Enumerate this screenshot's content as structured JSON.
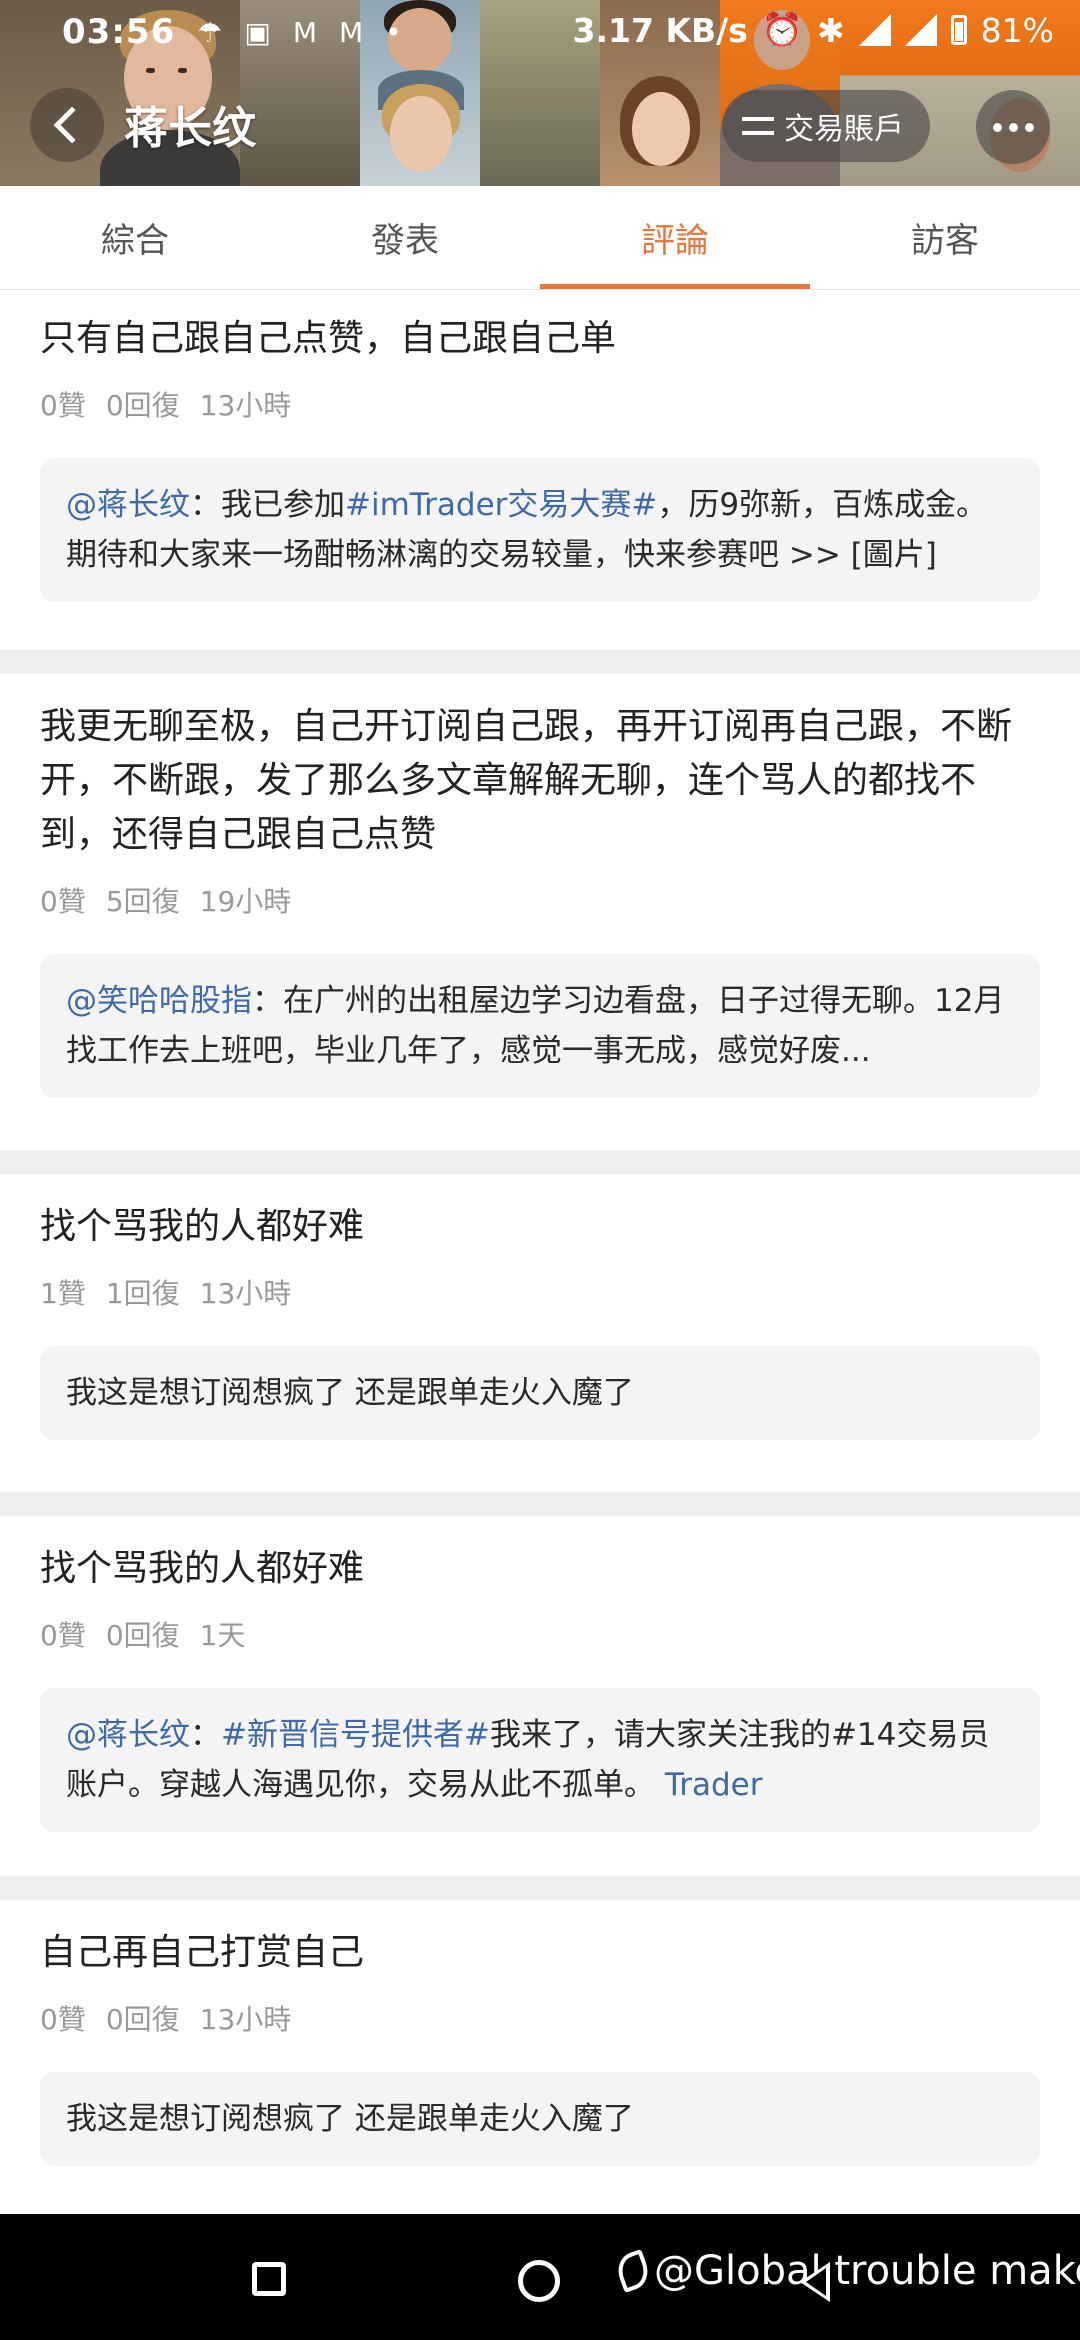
{
  "status_bar": {
    "time": "03:56",
    "net_speed": "3.17 KB/s",
    "battery": "81%",
    "left_icons": [
      "weather-icon",
      "image-icon",
      "gmail-icon",
      "gmail-icon"
    ]
  },
  "header": {
    "profile_name": "蒋长纹",
    "trade_account_label": "交易賬戶"
  },
  "tabs": [
    {
      "label": "綜合",
      "active": false
    },
    {
      "label": "發表",
      "active": false
    },
    {
      "label": "評論",
      "active": true
    },
    {
      "label": "訪客",
      "active": false
    }
  ],
  "comments": [
    {
      "text": "只有自己跟自己点赞，自己跟自己单",
      "likes": "0贊",
      "replies": "0回復",
      "time": "13小時",
      "quote": {
        "mention": "@蒋长纹",
        "sep": "：我已参加",
        "hashtag": "#imTrader交易大赛#",
        "body": "，历9弥新，百炼成金。期待和大家来一场酣畅淋漓的交易较量，快来参赛吧 >> [圖片]"
      }
    },
    {
      "text": "我更无聊至极，自己开订阅自己跟，再开订阅再自己跟，不断开，不断跟，发了那么多文章解解无聊，连个骂人的都找不到，还得自己跟自己点赞",
      "likes": "0贊",
      "replies": "5回復",
      "time": "19小時",
      "quote": {
        "mention": "@笑哈哈股指",
        "body": "：在广州的出租屋边学习边看盘，日子过得无聊。12月找工作去上班吧，毕业几年了，感觉一事无成，感觉好废..."
      }
    },
    {
      "text": "找个骂我的人都好难",
      "likes": "1贊",
      "replies": "1回復",
      "time": "13小時",
      "quote": {
        "body": "我这是想订阅想疯了 还是跟单走火入魔了"
      }
    },
    {
      "text": "找个骂我的人都好难",
      "likes": "0贊",
      "replies": "0回復",
      "time": "1天",
      "quote": {
        "mention": "@蒋长纹",
        "sep": "：",
        "hashtag": "#新晋信号提供者#",
        "body": "我来了，请大家关注我的#14交易员账户。穿越人海遇见你，交易从此不孤单。",
        "link": "Trader"
      }
    },
    {
      "text": "自己再自己打赏自己",
      "likes": "0贊",
      "replies": "0回復",
      "time": "13小時",
      "quote": {
        "body": "我这是想订阅想疯了 还是跟单走火入魔了"
      }
    }
  ],
  "watermark": "@Global trouble maker",
  "colors": {
    "accent": "#e8753a",
    "mention": "#3f6aa6",
    "meta": "#999999"
  }
}
